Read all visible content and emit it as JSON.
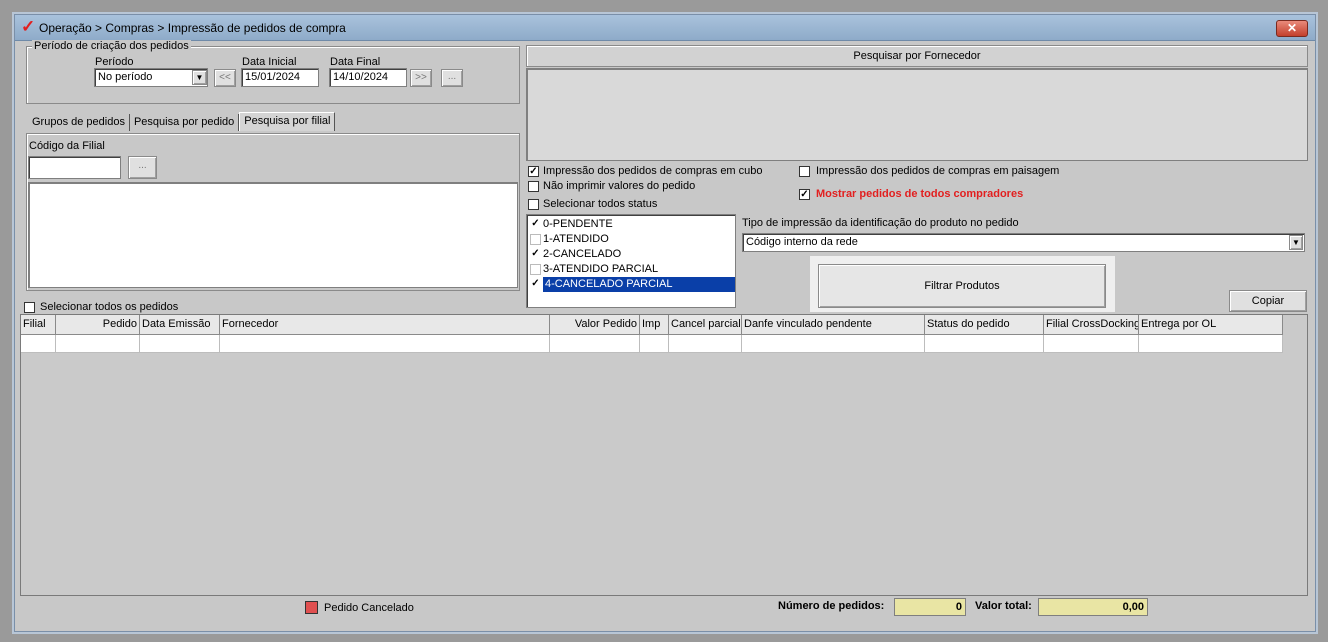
{
  "window": {
    "title": "Operação > Compras > Impressão de pedidos de compra",
    "logo_glyph": "✓",
    "close_glyph": "✕"
  },
  "period": {
    "group_label": "Período de criação dos pedidos",
    "period_label": "Período",
    "period_value": "No período",
    "start_label": "Data Inicial",
    "start_value": "15/01/2024",
    "end_label": "Data Final",
    "end_value": "14/10/2024",
    "prev_label": "<<",
    "next_label": ">>",
    "more_label": "..."
  },
  "tabs": [
    {
      "label": "Grupos de pedidos"
    },
    {
      "label": "Pesquisa por pedido"
    },
    {
      "label": "Pesquisa por filial"
    }
  ],
  "branch": {
    "code_label": "Código da Filial",
    "code_value": "",
    "browse_label": "..."
  },
  "supplier": {
    "header": "Pesquisar por Fornecedor"
  },
  "options": {
    "print_cube": {
      "label": "Impressão dos pedidos de compras em cubo",
      "checked": true
    },
    "no_values": {
      "label": "Não imprimir valores do pedido",
      "checked": false
    },
    "select_all_status": {
      "label": "Selecionar todos status",
      "checked": false
    },
    "landscape": {
      "label": "Impressão dos pedidos de compras em paisagem",
      "checked": false
    },
    "all_buyers": {
      "label": "Mostrar pedidos de todos compradores",
      "checked": true
    }
  },
  "status_list": [
    {
      "label": "0-PENDENTE",
      "checked": true,
      "selected": false
    },
    {
      "label": "1-ATENDIDO",
      "checked": false,
      "selected": false
    },
    {
      "label": "2-CANCELADO",
      "checked": true,
      "selected": false
    },
    {
      "label": "3-ATENDIDO PARCIAL",
      "checked": false,
      "selected": false
    },
    {
      "label": "4-CANCELADO PARCIAL",
      "checked": true,
      "selected": true
    }
  ],
  "print_type": {
    "label": "Tipo de impressão da identificação do produto no pedido",
    "value": "Código interno da rede"
  },
  "filter_button": "Filtrar Produtos",
  "copy_button": "Copiar",
  "select_all_orders": {
    "label": "Selecionar todos os pedidos",
    "checked": false
  },
  "table": {
    "columns": [
      "Filial",
      "Pedido",
      "Data Emissão",
      "Fornecedor",
      "Valor Pedido",
      "Imp",
      "Cancel parcial",
      "Danfe vinculado pendente",
      "Status do pedido",
      "Filial CrossDocking",
      "Entrega por OL"
    ],
    "rows": []
  },
  "footer": {
    "legend_label": "Pedido Cancelado",
    "legend_color": "#e05050",
    "count_label": "Número de pedidos:",
    "count_value": "0",
    "total_label": "Valor total:",
    "total_value": "0,00"
  },
  "colors": {
    "accent_red": "#e21f1f",
    "selection_blue": "#0a3fa8",
    "yellow_field": "#e9e5a4"
  }
}
